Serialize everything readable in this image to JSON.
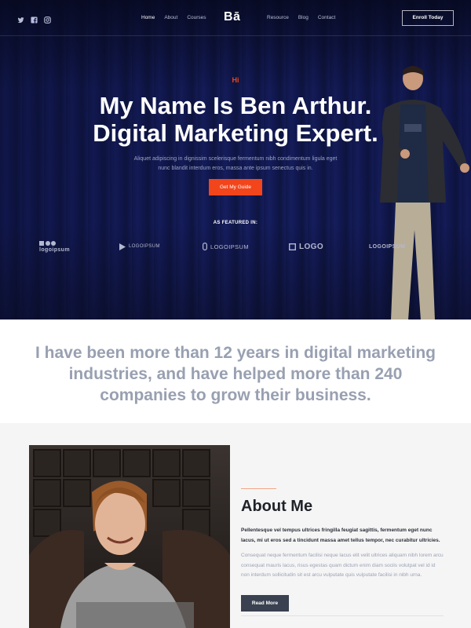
{
  "nav": {
    "social_icons": [
      "twitter-icon",
      "facebook-icon",
      "instagram-icon"
    ],
    "left_links": [
      "Home",
      "About",
      "Courses"
    ],
    "right_links": [
      "Resource",
      "Blog",
      "Contact"
    ],
    "active_link": "Home",
    "logo": "Bā",
    "cta": "Enroll Today"
  },
  "hero": {
    "greeting": "Hi",
    "headline_line1": "My Name Is Ben Arthur.",
    "headline_line2": "Digital Marketing Expert.",
    "subtext": "Aliquet adipiscing in dignissim scelerisque fermentum nibh condimentum ligula eget nunc blandit interdum eros, massa ante ipsum senectus quis in.",
    "button": "Get My Guide",
    "featured_label": "AS FEATURED IN:",
    "brands": [
      "logoipsum",
      "LOGOIPSUM",
      "LOGOIPSUM",
      "LOGO",
      "LOGOIPSUM"
    ]
  },
  "statement": {
    "text": "I have been more than 12 years in digital marketing industries, and have helped more than 240 companies to grow their business."
  },
  "about": {
    "title": "About Me",
    "lead": "Pellentesque vel tempus ultrices fringilla feugiat sagittis, fermentum eget nunc lacus, mi ut eros sed a tincidunt massa amet tellus tempor, nec curabitur ultricies.",
    "body": "Consequat neque fermentum facilisi neque lacus elit velit ultrices aliquam nibh lorem arcu consequat mauris lacus, risus egestas quam dictum enim diam sociis volutpat vel id id non interdum sollicitudin sit est arcu vulputate quis vulputate facilisi in nibh urna.",
    "button": "Read More"
  },
  "colors": {
    "accent": "#f2451c",
    "hero_bg": "#141c5a",
    "dark_button": "#3a4150",
    "statement_text": "#98a0b1"
  }
}
